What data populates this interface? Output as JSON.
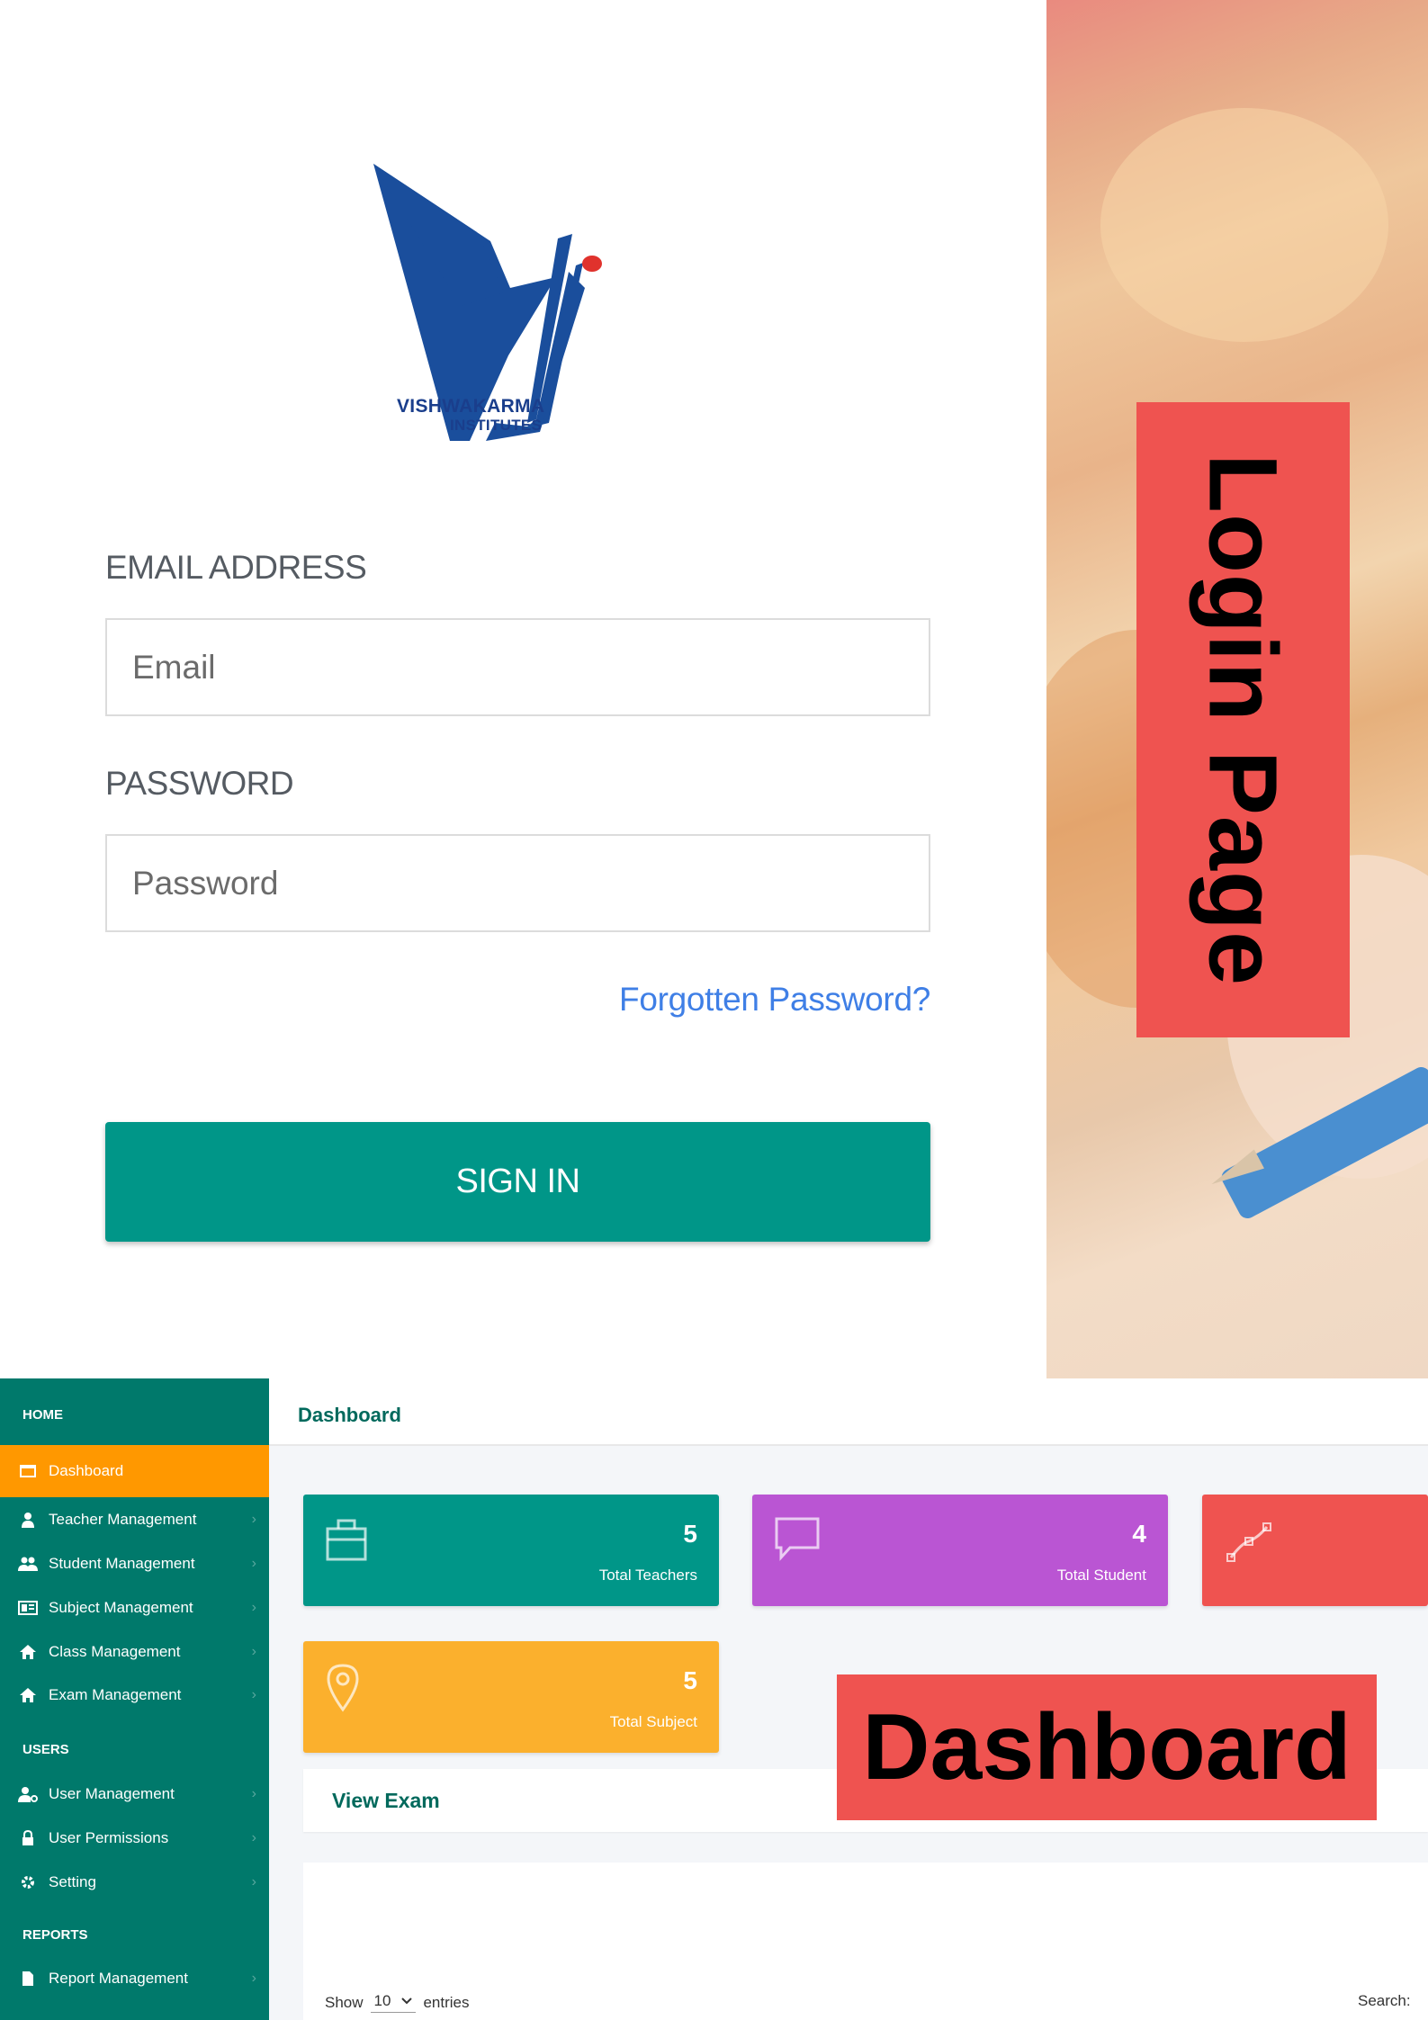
{
  "login": {
    "logo": {
      "line1": "VISHWAKARMA",
      "line2": "INSTITUTES"
    },
    "email_label": "EMAIL ADDRESS",
    "email_placeholder": "Email",
    "password_label": "PASSWORD",
    "password_placeholder": "Password",
    "forgot_label": "Forgotten Password?",
    "sign_in_label": "SIGN IN",
    "banner_label": "Login Page"
  },
  "dashboard": {
    "sidebar": {
      "home_heading": "HOME",
      "items": [
        {
          "label": "Dashboard",
          "icon": "dashboard-icon"
        },
        {
          "label": "Teacher Management",
          "icon": "user-icon"
        },
        {
          "label": "Student Management",
          "icon": "users-icon"
        },
        {
          "label": "Subject Management",
          "icon": "subject-icon"
        },
        {
          "label": "Class Management",
          "icon": "home-icon"
        },
        {
          "label": "Exam Management",
          "icon": "home-icon"
        }
      ],
      "users_heading": "USERS",
      "user_items": [
        {
          "label": "User Management",
          "icon": "user-cog-icon"
        },
        {
          "label": "User Permissions",
          "icon": "lock-icon"
        },
        {
          "label": "Setting",
          "icon": "gear-icon"
        }
      ],
      "reports_heading": "REPORTS",
      "report_items": [
        {
          "label": "Report Management",
          "icon": "file-icon"
        }
      ]
    },
    "topbar_title": "Dashboard",
    "cards": [
      {
        "value": "5",
        "label": "Total Teachers",
        "color": "#009688",
        "icon": "briefcase-icon"
      },
      {
        "value": "4",
        "label": "Total Student",
        "color": "#ba55d3",
        "icon": "chat-icon"
      },
      {
        "value": "",
        "label": "",
        "color": "#ef5350",
        "icon": "vector-icon"
      },
      {
        "value": "5",
        "label": "Total Subject",
        "color": "#fbb02d",
        "icon": "location-icon"
      }
    ],
    "view_exam_label": "View Exam",
    "table": {
      "show_label": "Show",
      "entries_value": "10",
      "entries_label": "entries",
      "search_label": "Search:"
    },
    "banner_label": "Dashboard"
  }
}
